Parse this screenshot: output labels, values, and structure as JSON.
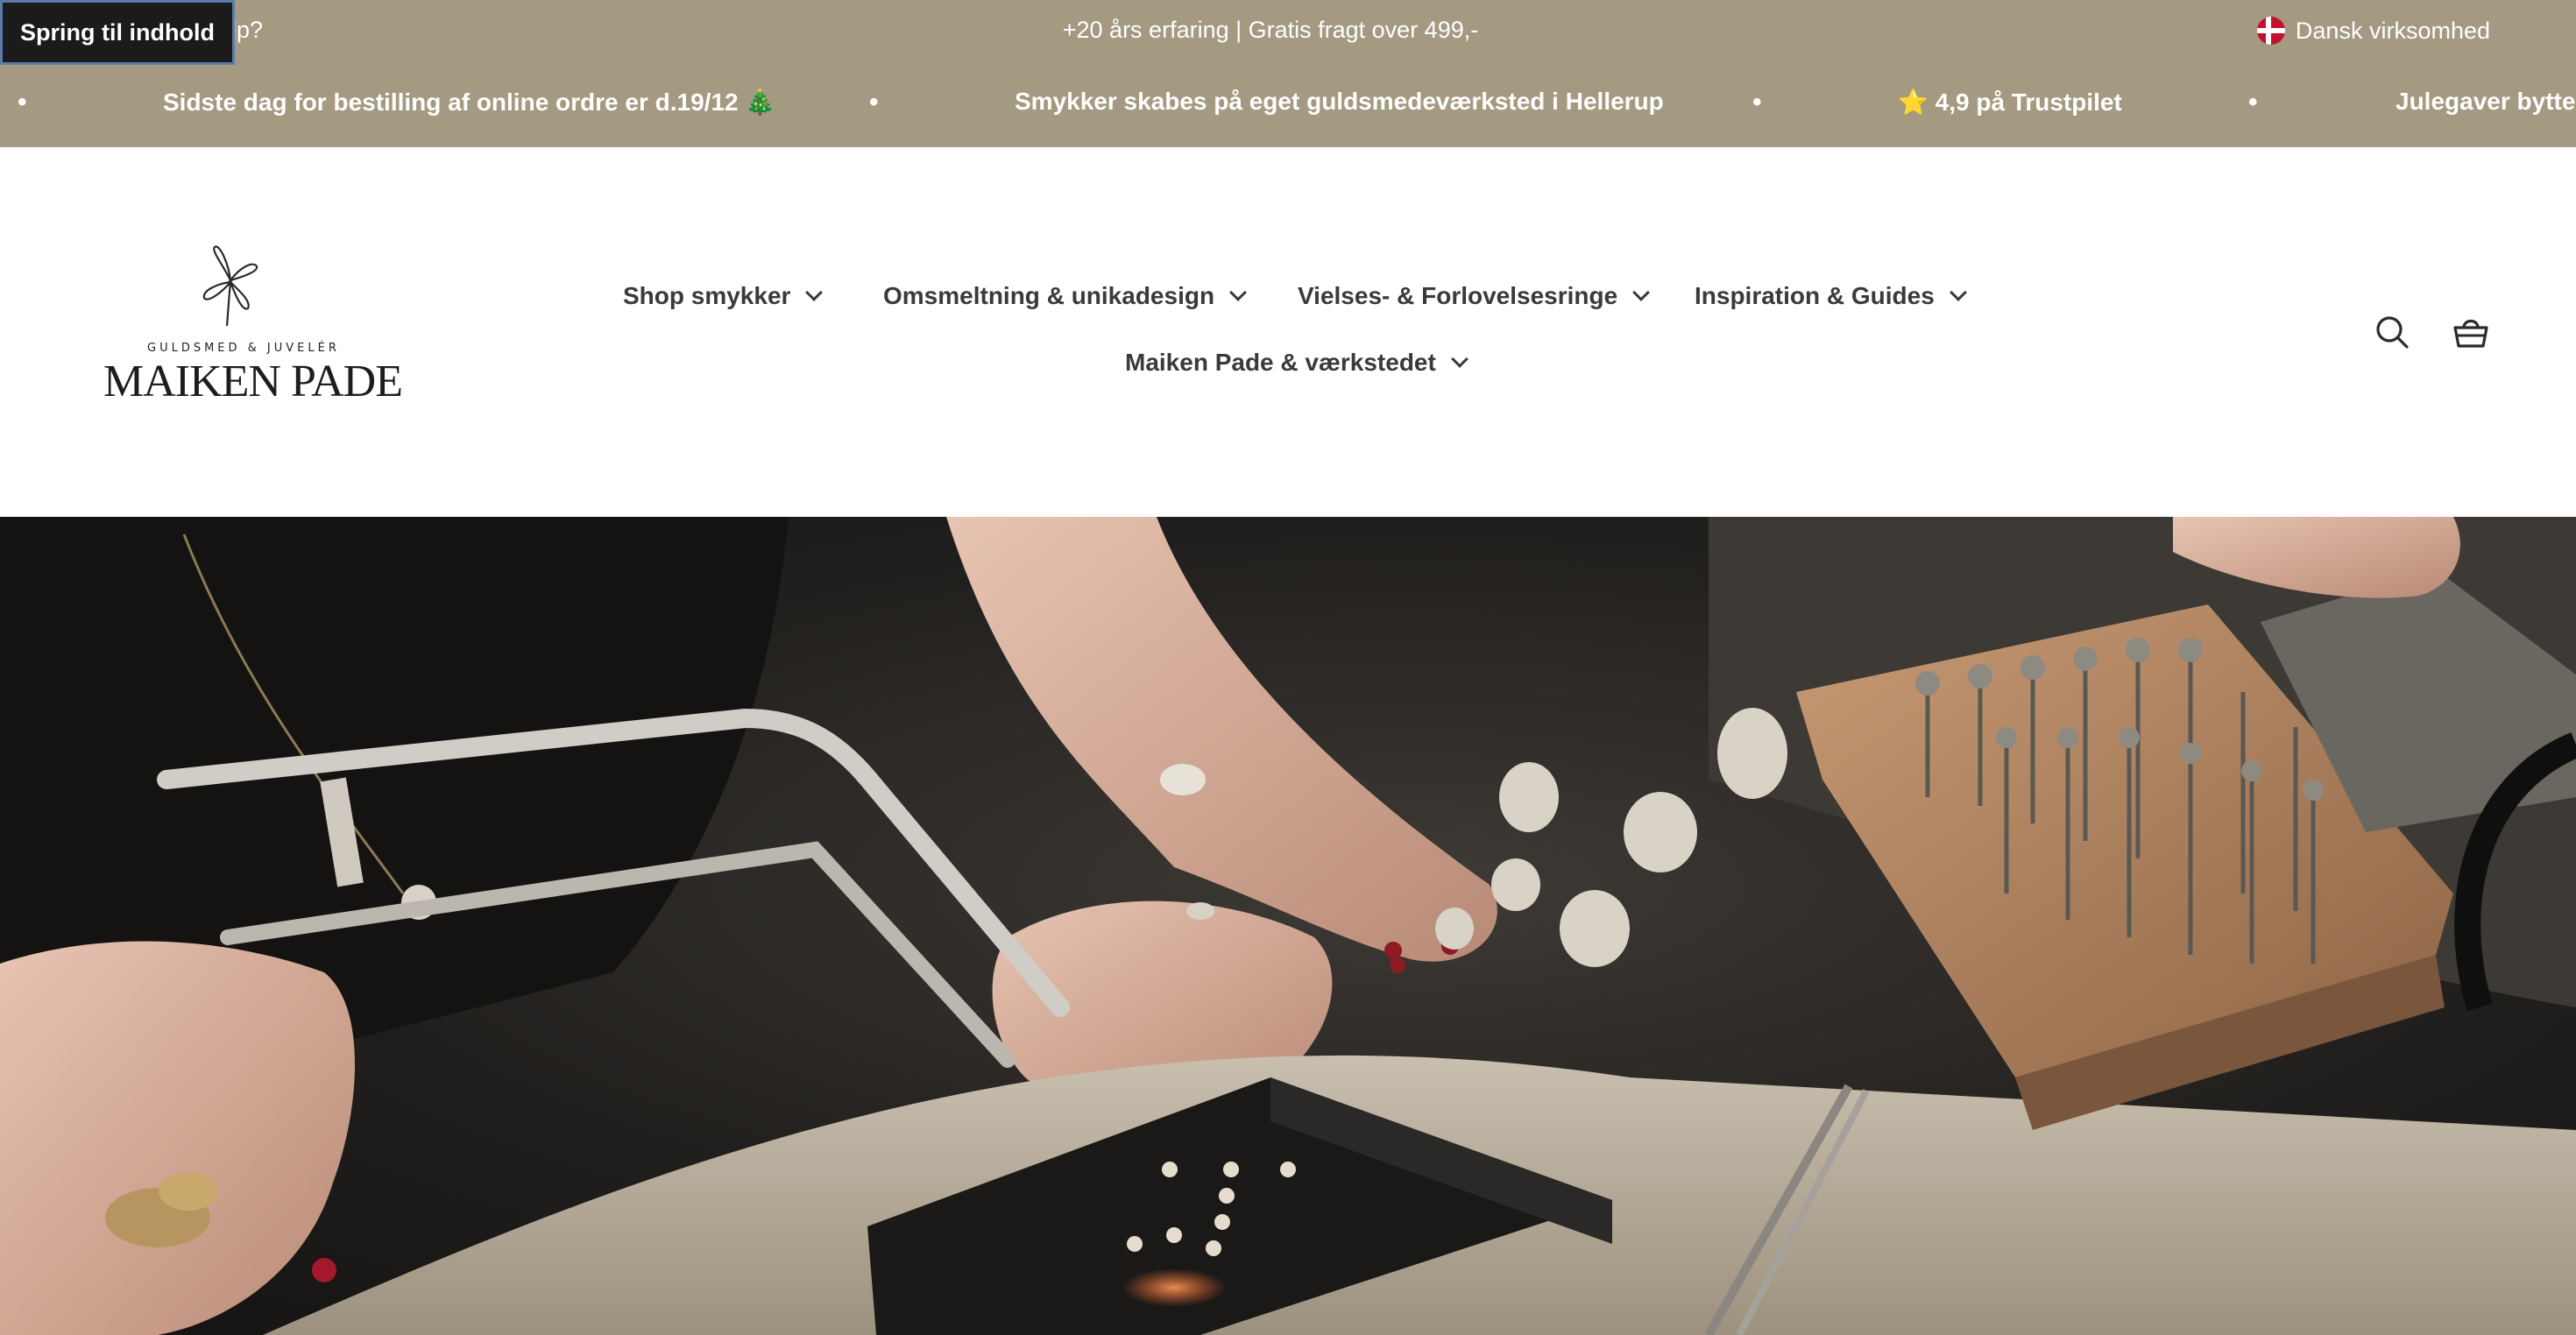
{
  "skip_link": {
    "label": "Spring til indhold"
  },
  "topbar": {
    "help_text": "ælp?",
    "center_text": "+20 års erfaring | Gratis fragt over 499,-",
    "right_text": "Dansk virksomhed",
    "flag_icon": "danish-flag-icon"
  },
  "marquee": {
    "bullet": "•",
    "items": [
      "Sidste dag for bestilling af online ordre er d.19/12 🎄",
      "Smykker skabes på eget guldsmedeværksted i Hellerup",
      "⭐ 4,9 på Trustpilet",
      "Julegaver byttes"
    ]
  },
  "logo": {
    "tagline": "GULDSMED & JUVELÉR",
    "name": "MAIKEN PADE",
    "icon": "dragonfly-logo-icon"
  },
  "nav": {
    "items": [
      {
        "label": "Shop smykker"
      },
      {
        "label": "Omsmeltning & unikadesign"
      },
      {
        "label": "Vielses- & Forlovelsesringe"
      },
      {
        "label": "Inspiration & Guides"
      },
      {
        "label": "Maiken Pade & værkstedet"
      }
    ],
    "search_icon": "search-icon",
    "cart_icon": "basket-icon"
  },
  "hero": {
    "image": "goldsmith-workshop-photo"
  },
  "colors": {
    "brand_bar": "#a39a81",
    "text_dark": "#3a3a3a",
    "hero_dark": "#1c1b19"
  }
}
